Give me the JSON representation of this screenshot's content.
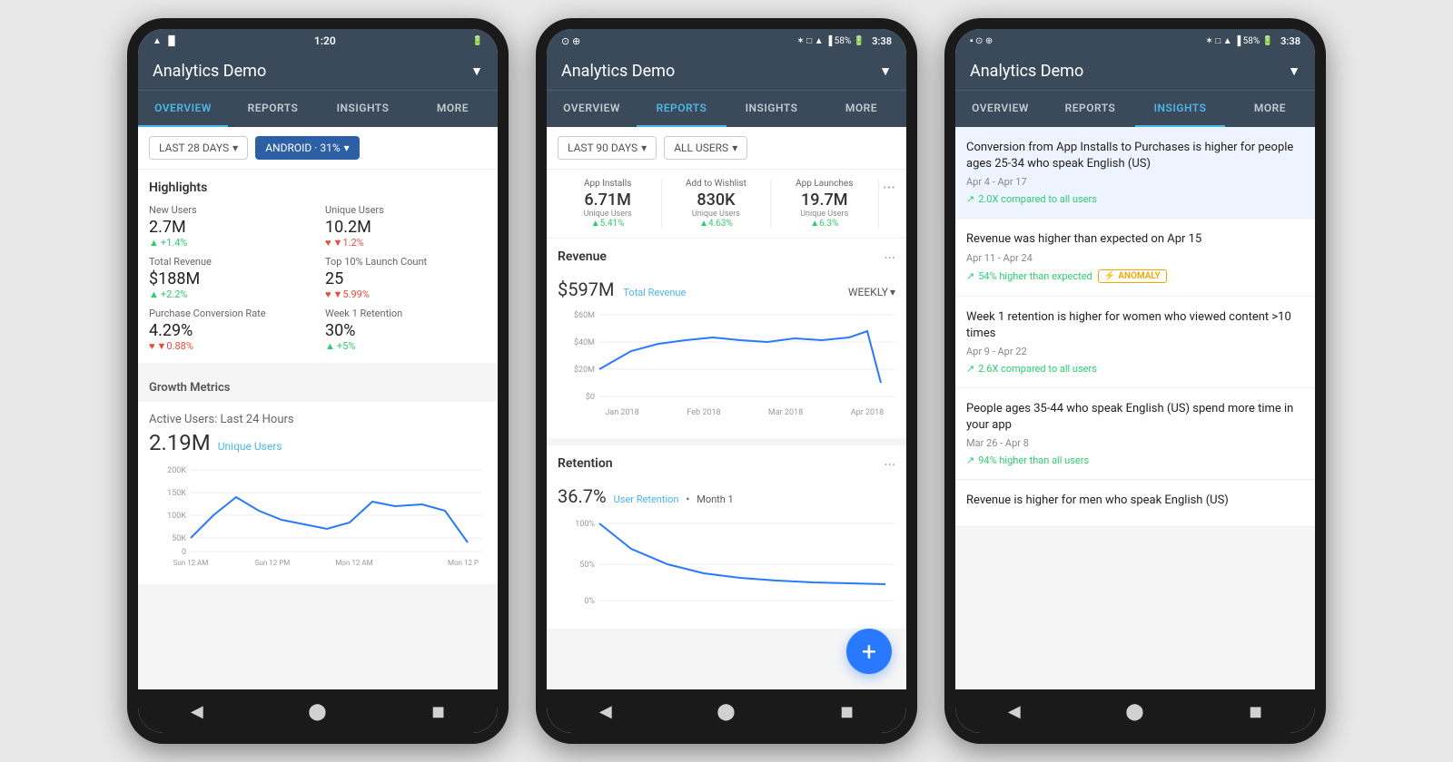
{
  "phone1": {
    "status": {
      "time": "1:20",
      "icons": "▲▌▐ 🔋"
    },
    "header": {
      "title": "Analytics Demo",
      "dropdown": "▼"
    },
    "tabs": [
      {
        "label": "Overview",
        "active": true
      },
      {
        "label": "Reports",
        "active": false
      },
      {
        "label": "Insights",
        "active": false
      },
      {
        "label": "More",
        "active": false
      }
    ],
    "filters": {
      "period": "LAST 28 DAYS",
      "segment": "ANDROID · 31%"
    },
    "highlights": {
      "title": "Highlights",
      "items": [
        {
          "label": "New Users",
          "value": "2.7M",
          "change": "+1.4%",
          "direction": "up"
        },
        {
          "label": "Unique Users",
          "value": "10.2M",
          "change": "▼1.2%",
          "direction": "down"
        },
        {
          "label": "Total Revenue",
          "value": "$188M",
          "change": "+2.2%",
          "direction": "up"
        },
        {
          "label": "Top 10% Launch Count",
          "value": "25",
          "change": "▼5.99%",
          "direction": "down"
        },
        {
          "label": "Purchase Conversion Rate",
          "value": "4.29%",
          "change": "▼0.88%",
          "direction": "down"
        },
        {
          "label": "Week 1 Retention",
          "value": "30%",
          "change": "+5%",
          "direction": "up"
        }
      ]
    },
    "growth": {
      "title": "Growth Metrics",
      "active_users": {
        "label": "Active Users: Last 24 Hours",
        "value": "2.19M",
        "link": "Unique Users"
      },
      "chart": {
        "y_labels": [
          "200K",
          "150K",
          "100K",
          "50K",
          "0"
        ],
        "x_labels": [
          "Sun 12 AM",
          "Sun 12 PM",
          "Mon 12 AM",
          "Mon 12 P"
        ]
      }
    }
  },
  "phone2": {
    "status": {
      "left": "⊙ ⊕",
      "right": "58% 3:38"
    },
    "header": {
      "title": "Analytics Demo",
      "dropdown": "▼"
    },
    "tabs": [
      {
        "label": "OVERVIEW",
        "active": false
      },
      {
        "label": "REPORTS",
        "active": true
      },
      {
        "label": "INSIGHTS",
        "active": false
      },
      {
        "label": "MORE",
        "active": false
      }
    ],
    "filters": {
      "period": "LAST 90 DAYS",
      "segment": "ALL USERS"
    },
    "stats": [
      {
        "label": "App Installs",
        "value": "6.71M",
        "sub": "Unique Users",
        "change": "▲5.41%"
      },
      {
        "label": "Add to Wishlist",
        "value": "830K",
        "sub": "Unique Users",
        "change": "▲4.63%"
      },
      {
        "label": "App Launches",
        "value": "19.7M",
        "sub": "Unique Users",
        "change": "▲6.3%"
      }
    ],
    "revenue": {
      "label": "Revenue",
      "value": "$597M",
      "link": "Total Revenue",
      "period": "WEEKLY",
      "chart_y": [
        "$60M",
        "$40M",
        "$20M",
        "$0"
      ],
      "chart_x": [
        "Jan 2018",
        "Feb 2018",
        "Mar 2018",
        "Apr 2018"
      ]
    },
    "retention": {
      "label": "Retention",
      "value": "36.7%",
      "link": "User Retention",
      "period": "Month 1",
      "chart_y": [
        "100%",
        "50%",
        "0%"
      ]
    }
  },
  "phone3": {
    "status": {
      "left": "▪ ⊙ ⊕",
      "right": "58% 3:38"
    },
    "header": {
      "title": "Analytics Demo",
      "dropdown": "▼"
    },
    "tabs": [
      {
        "label": "OVERVIEW",
        "active": false
      },
      {
        "label": "REPORTS",
        "active": false
      },
      {
        "label": "INSIGHTS",
        "active": true
      },
      {
        "label": "MORE",
        "active": false
      }
    ],
    "insights": [
      {
        "title": "Conversion from App Installs to Purchases is higher for people ages 25-34 who speak English (US)",
        "date": "Apr 4 - Apr 17",
        "metric": "2.0X compared to all users",
        "highlight": true
      },
      {
        "title": "Revenue was higher than expected on Apr 15",
        "date": "Apr 11 - Apr 24",
        "metric": "54% higher than expected",
        "anomaly": true,
        "anomaly_label": "⚡ ANOMALY",
        "highlight": false
      },
      {
        "title": "Week 1 retention is higher for women who viewed content >10 times",
        "date": "Apr 9 - Apr 22",
        "metric": "2.6X compared to all users",
        "highlight": false
      },
      {
        "title": "People ages 35-44 who speak English (US) spend more time in your app",
        "date": "Mar 26 - Apr 8",
        "metric": "94% higher than all users",
        "highlight": false
      },
      {
        "title": "Revenue is higher for men who speak English (US)",
        "date": "",
        "metric": "",
        "highlight": false
      }
    ]
  }
}
